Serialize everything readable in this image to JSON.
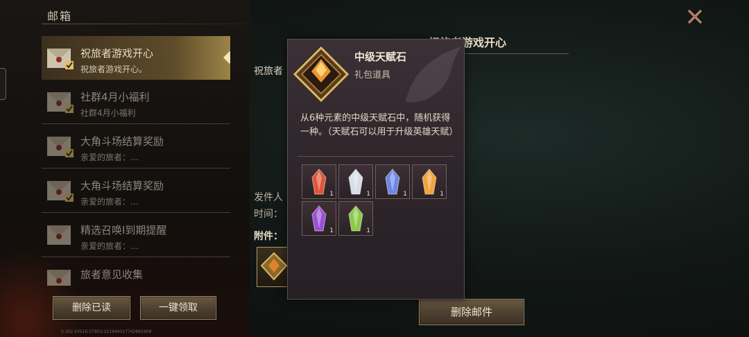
{
  "header": {
    "title": "邮箱"
  },
  "mails": [
    {
      "subject": "祝旅者游戏开心",
      "preview": "祝旅者游戏开心。",
      "selected": true
    },
    {
      "subject": "社群4月小福利",
      "preview": "社群4月小福利",
      "selected": false
    },
    {
      "subject": "大角斗场结算奖励",
      "preview": "亲爱的旅者：…",
      "selected": false
    },
    {
      "subject": "大角斗场结算奖励",
      "preview": "亲爱的旅者：…",
      "selected": false
    },
    {
      "subject": "精选召唤I到期提醒",
      "preview": "亲爱的旅者：…",
      "selected": false
    },
    {
      "subject": "旅者意见收集",
      "preview": "",
      "selected": false
    }
  ],
  "buttons": {
    "delete_read": "删除已读",
    "claim_all": "一键领取",
    "delete_mail": "删除邮件"
  },
  "version": "0.302.43516-57853-221944317742881908",
  "detail": {
    "title": "祝旅者游戏开心",
    "body": "祝旅者",
    "sender_label": "发件人",
    "time_label": "时间：",
    "attachments_label": "附件："
  },
  "tooltip": {
    "name": "中级天赋石",
    "type": "礼包道具",
    "description": "从6种元素的中级天赋石中，随机获得一种。（天赋石可以用于升级英雄天赋）",
    "items": [
      {
        "icon": "red-crystal-icon",
        "color": "#e0553a",
        "qty": "1"
      },
      {
        "icon": "white-crystal-icon",
        "color": "#d9dde6",
        "qty": "1"
      },
      {
        "icon": "blue-crystal-icon",
        "color": "#6f86e6",
        "qty": "1"
      },
      {
        "icon": "orange-crystal-icon",
        "color": "#f0a43a",
        "qty": "1"
      },
      {
        "icon": "purple-crystal-icon",
        "color": "#9b4fd6",
        "qty": "1"
      },
      {
        "icon": "green-crystal-icon",
        "color": "#8cc94a",
        "qty": "1"
      }
    ]
  }
}
